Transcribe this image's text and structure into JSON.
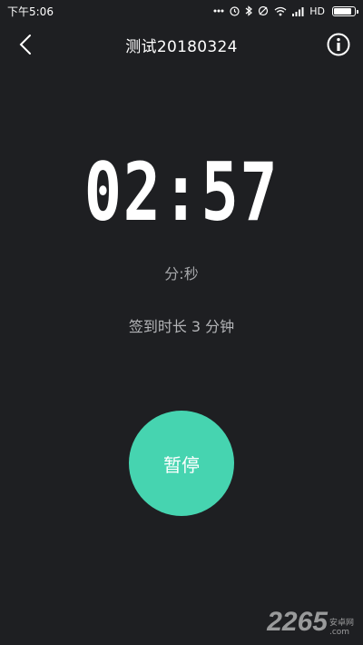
{
  "status_bar": {
    "time": "下午5:06",
    "network_label": "HD",
    "battery_level": 0.9,
    "icons": [
      "dots-icon",
      "alarm-icon",
      "bluetooth-icon",
      "no-disturb-icon",
      "wifi-icon",
      "signal-icon",
      "battery-icon"
    ]
  },
  "nav": {
    "title": "测试20180324",
    "back_icon": "chevron-left-icon",
    "info_icon": "info-icon"
  },
  "timer": {
    "display": "02:57",
    "unit_label": "分:秒",
    "duration_label": "签到时长 3 分钟"
  },
  "actions": {
    "pause_label": "暂停"
  },
  "watermark": {
    "number": "2265",
    "tail": ".com",
    "cn": "安卓网"
  },
  "colors": {
    "background": "#1e1f22",
    "accent": "#46d4b0",
    "secondary_text": "#a6a7aa"
  }
}
